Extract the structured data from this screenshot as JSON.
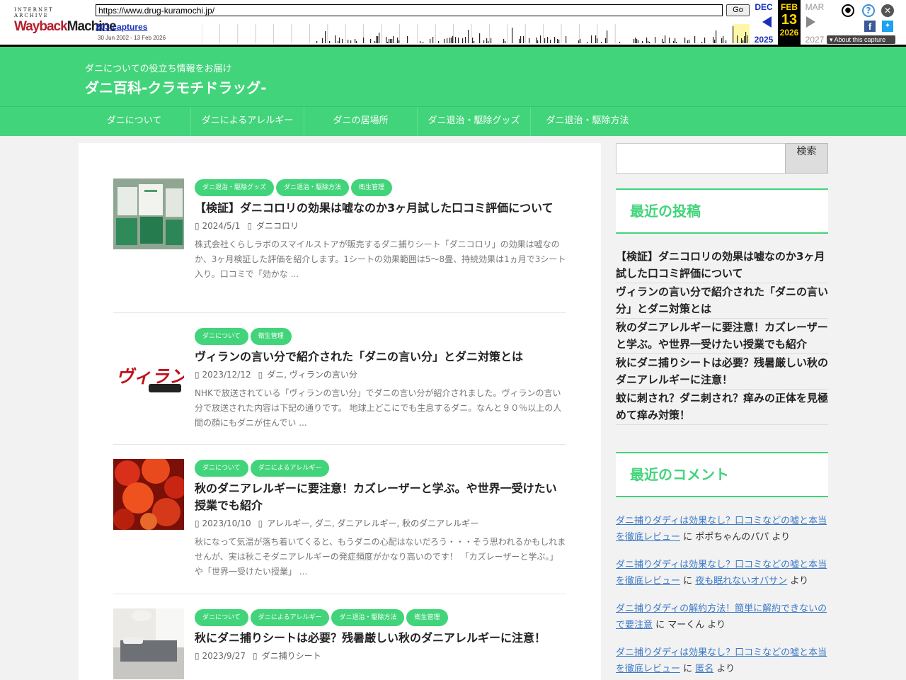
{
  "wayback": {
    "logo_top": "INTERNET ARCHIVE",
    "logo_main_a": "Wayback",
    "logo_main_b": "Machine",
    "url": "https://www.drug-kuramochi.jp/",
    "go_label": "Go",
    "captures": "203 captures",
    "range": "30 Jun 2002 - 13 Feb 2026",
    "prev_month": "DEC",
    "prev_year": "2025",
    "cur_month": "FEB",
    "cur_day": "13",
    "cur_year": "2026",
    "next_month": "MAR",
    "next_year": "2027",
    "about": "About this capture"
  },
  "site": {
    "tagline": "ダニについての役立ち情報をお届け",
    "title": "ダニ百科-クラモチドラッグ-"
  },
  "nav": [
    "ダニについて",
    "ダニによるアレルギー",
    "ダニの居場所",
    "ダニ退治・駆除グッズ",
    "ダニ退治・駆除方法"
  ],
  "posts": [
    {
      "cats": [
        "ダニ退治・駆除グッズ",
        "ダニ退治・駆除方法",
        "衛生管理"
      ],
      "title": "【検証】ダニコロリの効果は嘘なのか3ヶ月試した口コミ評価について",
      "date": "2024/5/1",
      "tags": "ダニコロリ",
      "excerpt": "株式会社くらしラボのスマイルストアが販売するダニ捕りシート「ダニコロリ」の効果は嘘なのか、3ヶ月検証した評価を紹介します。1シートの効果範囲は5～8畳、持続効果は1ヵ月で3シート入り。口コミで「効かな ..."
    },
    {
      "cats": [
        "ダニについて",
        "衛生管理"
      ],
      "title": "ヴィランの言い分で紹介された「ダニの言い分」とダニ対策とは",
      "date": "2023/12/12",
      "tags": "ダニ, ヴィランの言い分",
      "excerpt": "NHKで放送されている「ヴィランの言い分」でダニの言い分が紹介されました。ヴィランの言い分で放送された内容は下記の通りです。 地球上どこにでも生息するダニ。なんと９０％以上の人間の顔にもダニが住んでい ...",
      "thumb_text": "ヴィラン"
    },
    {
      "cats": [
        "ダニについて",
        "ダニによるアレルギー"
      ],
      "title": "秋のダニアレルギーに要注意！カズレーザーと学ぶ。や世界一受けたい授業でも紹介",
      "date": "2023/10/10",
      "tags": "アレルギー, ダニ, ダニアレルギー, 秋のダニアレルギー",
      "excerpt": "秋になって気温が落ち着いてくると、もうダニの心配はないだろう・・・そう思われるかもしれませんが、実は秋こそダニアレルギーの発症頻度がかなり高いのです！ 「カズレーザーと学ぶ。」や「世界一受けたい授業」 ..."
    },
    {
      "cats": [
        "ダニについて",
        "ダニによるアレルギー",
        "ダニ退治・駆除方法",
        "衛生管理"
      ],
      "title": "秋にダニ捕りシートは必要？残暑厳しい秋のダニアレルギーに注意！",
      "date": "2023/9/27",
      "tags": "ダニ捕りシート"
    }
  ],
  "sidebar": {
    "search_label": "検索",
    "recent_title": "最近の投稿",
    "recent": [
      "【検証】ダニコロリの効果は嘘なのか3ヶ月試した口コミ評価について",
      "ヴィランの言い分で紹介された「ダニの言い分」とダニ対策とは",
      "秋のダニアレルギーに要注意！カズレーザーと学ぶ。や世界一受けたい授業でも紹介",
      "秋にダニ捕りシートは必要？残暑厳しい秋のダニアレルギーに注意！",
      "蚊に刺され？ダニ刺され？痒みの正体を見極めて痒み対策！"
    ],
    "comments_title": "最近のコメント",
    "comments": [
      {
        "post": "ダニ捕りダディは効果なし？口コミなどの嘘と本当を徹底レビュー",
        "sep": " に ",
        "author": "ポポちゃんのパパ",
        "suffix": " より",
        "author_link": false
      },
      {
        "post": "ダニ捕りダディは効果なし？口コミなどの嘘と本当を徹底レビュー",
        "sep": " に ",
        "author": "夜も眠れないオバサン",
        "suffix": " より",
        "author_link": true
      },
      {
        "post": "ダニ捕りダディの解約方法！簡単に解約できないので要注意",
        "sep": " に ",
        "author": "マーくん",
        "suffix": " より",
        "author_link": false
      },
      {
        "post": "ダニ捕りダディは効果なし？口コミなどの嘘と本当を徹底レビュー",
        "sep": " に ",
        "author": "匿名",
        "suffix": " より",
        "author_link": true
      }
    ]
  },
  "colors": {
    "brand_green": "#42d47a",
    "link_blue": "#3b79c8"
  }
}
